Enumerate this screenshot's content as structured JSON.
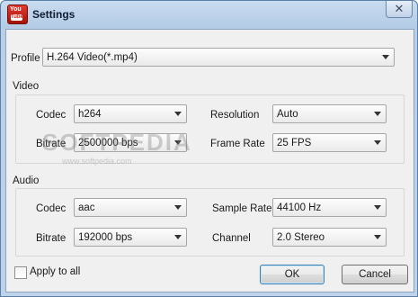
{
  "window": {
    "title": "Settings",
    "close_glyph": "✕"
  },
  "app_icon": {
    "top": "You",
    "bottom": "Tube"
  },
  "profile": {
    "label": "Profile",
    "value": "H.264 Video(*.mp4)"
  },
  "video": {
    "title": "Video",
    "codec_label": "Codec",
    "codec_value": "h264",
    "bitrate_label": "Bitrate",
    "bitrate_value": "2500000 bps",
    "resolution_label": "Resolution",
    "resolution_value": "Auto",
    "framerate_label": "Frame Rate",
    "framerate_value": "25 FPS"
  },
  "audio": {
    "title": "Audio",
    "codec_label": "Codec",
    "codec_value": "aac",
    "bitrate_label": "Bitrate",
    "bitrate_value": "192000 bps",
    "samplerate_label": "Sample Rate",
    "samplerate_value": "44100 Hz",
    "channel_label": "Channel",
    "channel_value": "2.0 Stereo"
  },
  "apply_to_all": {
    "label": "Apply to all",
    "checked": false
  },
  "buttons": {
    "ok": "OK",
    "cancel": "Cancel"
  },
  "watermark": {
    "main": "SOFTPEDIA",
    "url": "www.softpedia.com"
  }
}
